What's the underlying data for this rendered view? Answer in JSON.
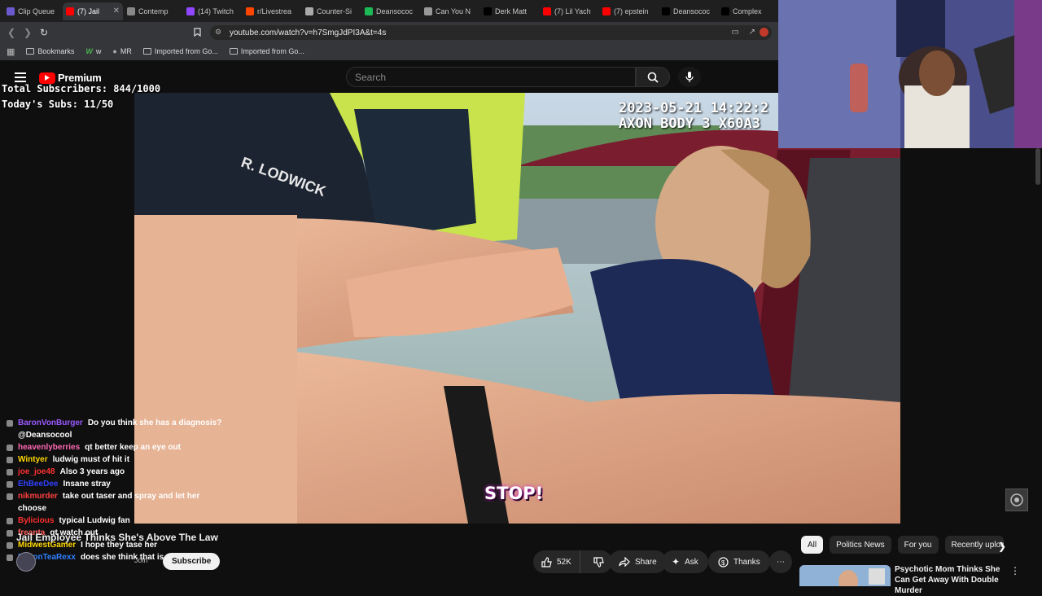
{
  "tabs": [
    {
      "label": "Clip Queue",
      "color": "#6a5acd",
      "active": false
    },
    {
      "label": "(7) Jail",
      "color": "#ff0000",
      "active": true
    },
    {
      "label": "Contemp",
      "color": "#888888",
      "active": false
    },
    {
      "label": "(14) Twitch",
      "color": "#9146ff",
      "active": false
    },
    {
      "label": "r/Livestrea",
      "color": "#ff4500",
      "active": false
    },
    {
      "label": "Counter-Si",
      "color": "#aaaaaa",
      "active": false
    },
    {
      "label": "Deansococ",
      "color": "#1db954",
      "active": false
    },
    {
      "label": "Can You N",
      "color": "#999999",
      "active": false
    },
    {
      "label": "Derk Matt",
      "color": "#000000",
      "active": false
    },
    {
      "label": "(7) Lil Yach",
      "color": "#ff0000",
      "active": false
    },
    {
      "label": "(7) epstein",
      "color": "#ff0000",
      "active": false
    },
    {
      "label": "Deansococ",
      "color": "#000000",
      "active": false
    },
    {
      "label": "Complex",
      "color": "#000000",
      "active": false
    }
  ],
  "address": {
    "url": "youtube.com/watch?v=h7SmgJdPI3A&t=4s"
  },
  "bookmarks": [
    "Bookmarks",
    "w",
    "MR",
    "Imported from Go...",
    "Imported from Go..."
  ],
  "yt": {
    "brand": "Premium",
    "search_placeholder": "Search",
    "title": "Jail Employee Thinks She's Above The Law",
    "likes": "52K",
    "share": "Share",
    "ask": "Ask",
    "thanks": "Thanks",
    "join": "Join",
    "subscribe": "Subscribe",
    "chips": [
      "All",
      "Politics News",
      "For you",
      "Recently uploa"
    ],
    "rec_title": "Psychotic Mom Thinks She Can Get Away With Double Murder"
  },
  "overlay": {
    "total_subs": "Total Subscribers: 844/1000",
    "today_subs": "Today's Subs: 11/50",
    "timestamp": "2023-05-21 14:22:2",
    "camera": "AXON BODY 3 X60A3",
    "caption": "STOP!",
    "badge": "R. LODWICK"
  },
  "chat": [
    {
      "user": "BaronVonBurger",
      "color": "#9b59ff",
      "text": "Do you think she has a diagnosis? @Deansocool"
    },
    {
      "user": "heavenlyberries",
      "color": "#ff69b4",
      "text": "qt better keep an eye out"
    },
    {
      "user": "Wintyer",
      "color": "#ffd700",
      "text": "ludwig must of hit it"
    },
    {
      "user": "joe_joe48",
      "color": "#ff3030",
      "text": "Also 3 years ago"
    },
    {
      "user": "EhBeeDee",
      "color": "#3040ff",
      "text": "Insane stray"
    },
    {
      "user": "nikmurder",
      "color": "#ff4040",
      "text": "take out taser and spray and let her choose"
    },
    {
      "user": "Bylicious",
      "color": "#ff3030",
      "text": "typical Ludwig fan"
    },
    {
      "user": "freanta",
      "color": "#ff6060",
      "text": "qt watch out"
    },
    {
      "user": "MidwestGamer",
      "color": "#ffd700",
      "text": "I hope they tase her"
    },
    {
      "user": "BaconTeaRexx",
      "color": "#3080ff",
      "text": "does she think that is a word"
    }
  ]
}
